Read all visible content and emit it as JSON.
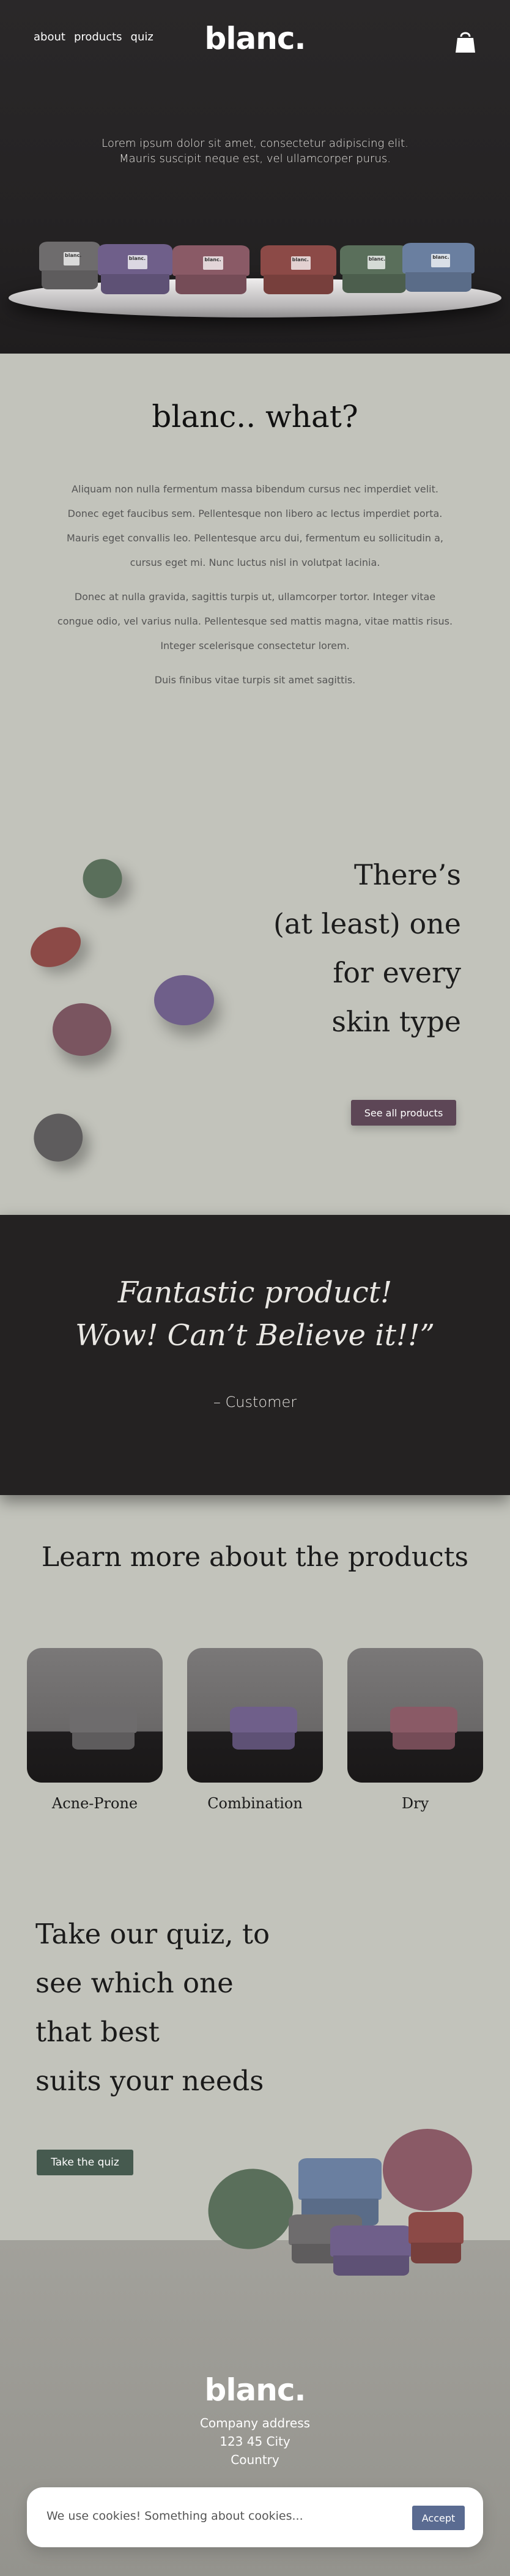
{
  "nav": {
    "items": [
      "about",
      "products",
      "quiz"
    ]
  },
  "brand": {
    "logo": "blanc."
  },
  "hero": {
    "text_line1": "Lorem ipsum dolor sit amet, consectetur adipiscing elit.",
    "text_line2": "Mauris suscipit neque est, vel ullamcorper purus.",
    "jar_label": "blanc."
  },
  "about": {
    "title": "blanc.. what?",
    "para1": "Aliquam non nulla fermentum massa bibendum cursus nec imperdiet velit. Donec eget faucibus sem. Pellentesque non libero ac lectus imperdiet porta. Mauris eget convallis leo. Pellentesque arcu dui, fermentum eu sollicitudin a, cursus eget mi. Nunc luctus nisl in volutpat lacinia.",
    "para2": "Donec at nulla gravida, sagittis turpis ut, ullamcorper tortor. Integer vitae congue odio, vel varius nulla. Pellentesque sed mattis magna, vitae mattis risus. Integer scelerisque consectetur lorem.",
    "para3": "Duis finibus vitae turpis sit amet sagittis."
  },
  "skin": {
    "line1": "There’s",
    "line2": "(at least) one",
    "line3": "for every",
    "line4": "skin type",
    "button": "See all products"
  },
  "testimonial": {
    "line1": "Fantastic product!",
    "line2": "Wow! Can’t Believe it!!”",
    "author": "– Customer"
  },
  "products": {
    "title": "Learn more about the products",
    "cards": [
      "Acne-Prone",
      "Combination",
      "Dry"
    ]
  },
  "quiz": {
    "line1": "Take our quiz, to",
    "line2": "see which one",
    "line3": "that best",
    "line4": "suits your needs",
    "button": "Take the quiz"
  },
  "footer": {
    "logo": "blanc.",
    "address1": "Company address",
    "address2": "123 45 City",
    "address3": "Country"
  },
  "cookie": {
    "text": "We use cookies! Something about cookies...",
    "button": "Accept"
  },
  "colors": {
    "hero_bg": "#242222",
    "page_bg": "#c2c3bb",
    "see_all_button": "#5d4656",
    "quiz_button": "#465a4f",
    "cookie_button": "#5a6b91",
    "jar_gray": "#6e6c6d",
    "jar_purple": "#6f5f8a",
    "jar_mauve": "#8a5a66",
    "jar_red": "#8c4a47",
    "jar_green": "#5a6f5b",
    "jar_blue": "#6a7fa0"
  }
}
